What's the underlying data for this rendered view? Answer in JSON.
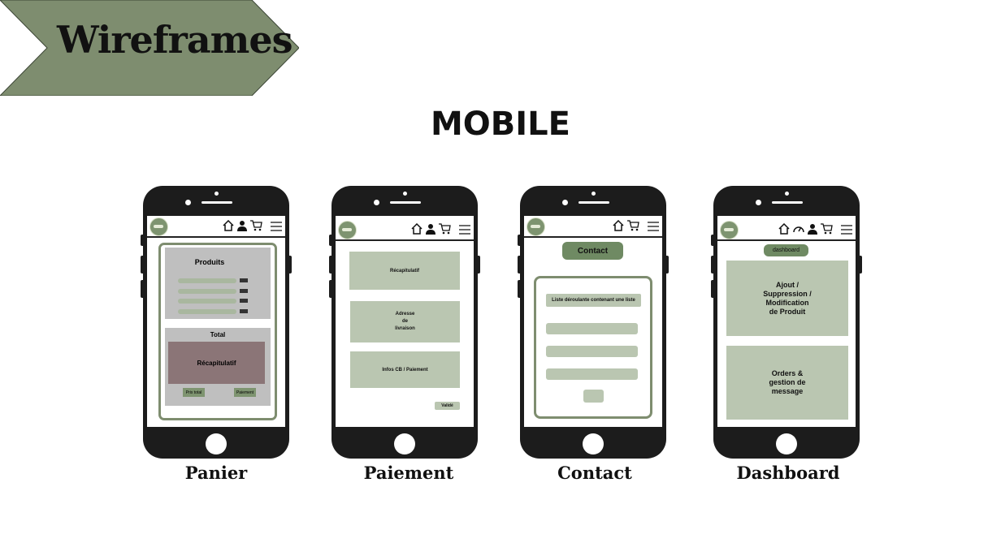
{
  "header": {
    "banner_title": "Wireframes",
    "section_title": "MOBILE"
  },
  "colors": {
    "sage": "#7e8d6f",
    "light_sage": "#bac6b1",
    "dark_green": "#6f8a63",
    "phone": "#1c1c1c",
    "mauve": "#8b7577",
    "grey": "#bfbfbf"
  },
  "phones": {
    "panier": {
      "caption": "Panier",
      "products_title": "Produits",
      "total_title": "Total",
      "recap_label": "Récapitulatif",
      "prix_total": "Prix total",
      "paiement_btn": "Paiement",
      "icons": [
        "home-icon",
        "user-icon",
        "cart-icon",
        "menu-icon"
      ]
    },
    "paiement": {
      "caption": "Paiement",
      "recap_label": "Récapitulatif",
      "adresse_label": "Adresse\nde\nlivraison",
      "infos_label": "Infos CB / Paiement",
      "valide_btn": "Validé",
      "icons": [
        "home-icon",
        "user-icon",
        "cart-icon",
        "menu-icon"
      ]
    },
    "contact": {
      "caption": "Contact",
      "title_btn": "Contact",
      "dropdown_label": "Liste déroulante contenant une liste",
      "icons": [
        "home-icon",
        "cart-icon",
        "menu-icon"
      ]
    },
    "dashboard": {
      "caption": "Dashboard",
      "title_btn": "dashboard",
      "card1": "Ajout /\nSuppression /\nModification\nde Produit",
      "card2": "Orders &\ngestion de\nmessage",
      "icons": [
        "home-icon",
        "gauge-icon",
        "user-icon",
        "cart-icon",
        "menu-icon"
      ]
    }
  }
}
